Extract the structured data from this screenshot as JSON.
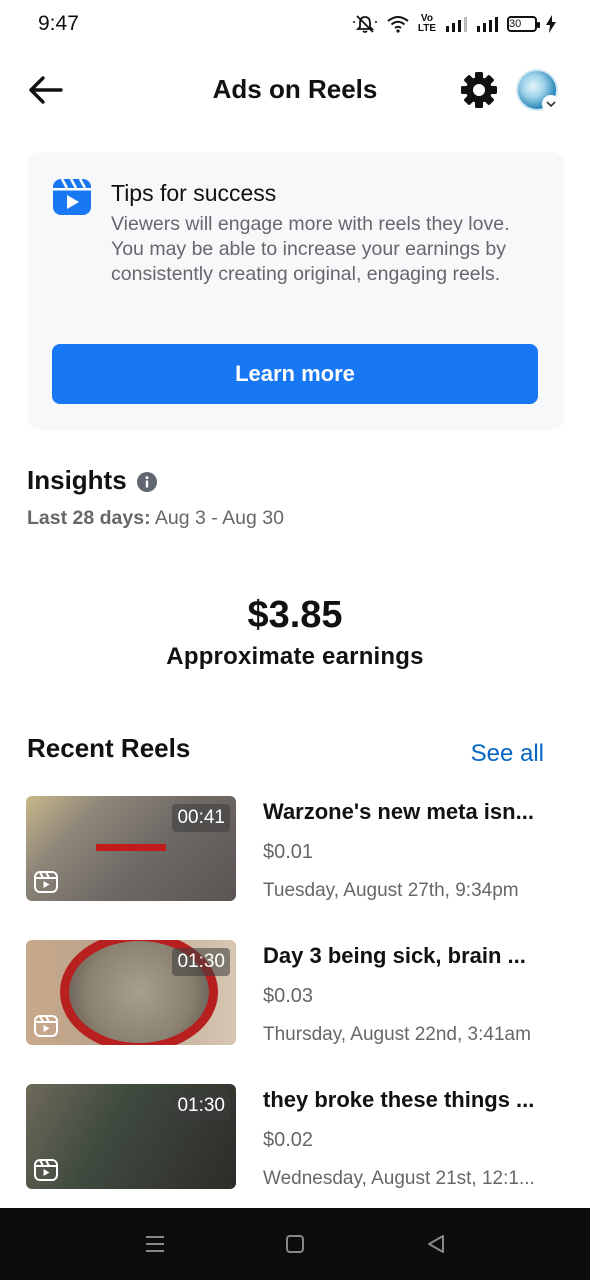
{
  "status_bar": {
    "time": "9:47",
    "network_label": "Vo\nLTE",
    "battery_level": "30"
  },
  "header": {
    "title": "Ads on Reels",
    "back_icon": "arrow-left-icon",
    "settings_icon": "gear-icon"
  },
  "tips": {
    "title": "Tips for success",
    "body": "Viewers will engage more with reels they love. You may be able to increase your earnings by consistently creating original, engaging reels.",
    "button_label": "Learn more",
    "icon": "reels-icon"
  },
  "insights": {
    "title": "Insights",
    "range_label": "Last 28 days:",
    "range_value": "Aug 3 - Aug 30",
    "earnings_amount": "$3.85",
    "earnings_label": "Approximate earnings"
  },
  "recent": {
    "title": "Recent Reels",
    "see_all": "See all",
    "items": [
      {
        "title": "Warzone's new meta isn...",
        "duration": "00:41",
        "amount": "$0.01",
        "date": "Tuesday, August 27th, 9:34pm"
      },
      {
        "title": "Day 3 being sick, brain ...",
        "duration": "01:30",
        "amount": "$0.03",
        "date": "Thursday, August 22nd, 3:41am"
      },
      {
        "title": "they broke these things ...",
        "duration": "01:30",
        "amount": "$0.02",
        "date": "Wednesday, August 21st, 12:1..."
      }
    ]
  },
  "colors": {
    "accent": "#1877f2",
    "link": "#0866c4",
    "secondary_text": "#65676b",
    "card_bg": "#f7f8fa"
  }
}
